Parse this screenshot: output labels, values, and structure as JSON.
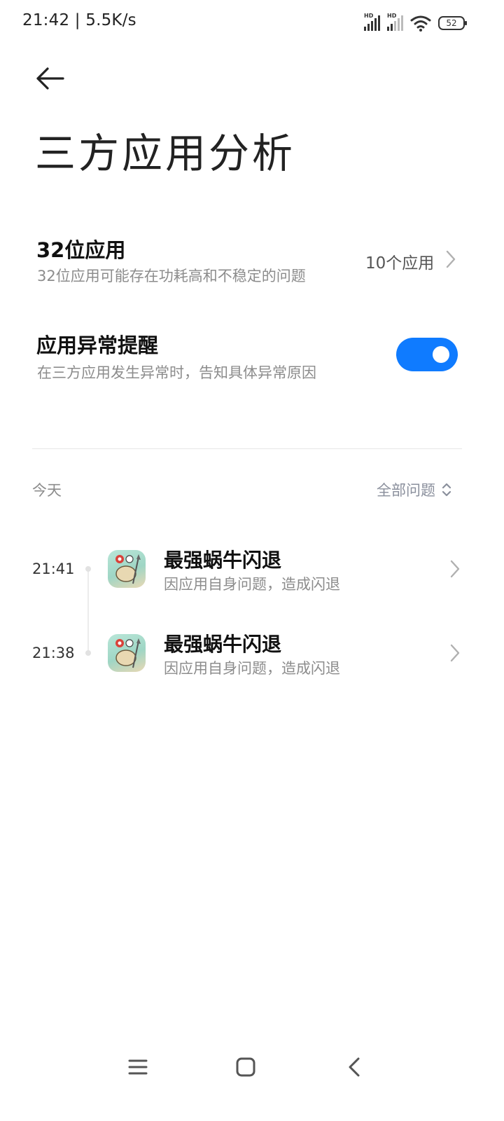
{
  "status_bar": {
    "time_speed": "21:42 | 5.5K/s",
    "hd_label": "HD",
    "battery": "52"
  },
  "header": {
    "title": "三方应用分析"
  },
  "settings": {
    "app32": {
      "title": "32位应用",
      "subtitle": "32位应用可能存在功耗高和不稳定的问题",
      "value": "10个应用"
    },
    "alert": {
      "title": "应用异常提醒",
      "subtitle": "在三方应用发生异常时，告知具体异常原因",
      "enabled": true,
      "accent": "#0f7bff"
    }
  },
  "log": {
    "section_label": "今天",
    "filter_label": "全部问题",
    "items": [
      {
        "time": "21:41",
        "title": "最强蜗牛闪退",
        "subtitle": "因应用自身问题，造成闪退",
        "icon": "snail-game-icon"
      },
      {
        "time": "21:38",
        "title": "最强蜗牛闪退",
        "subtitle": "因应用自身问题，造成闪退",
        "icon": "snail-game-icon"
      }
    ]
  },
  "nav_bar": {
    "icons": [
      "menu-icon",
      "home-icon",
      "back-icon"
    ]
  }
}
